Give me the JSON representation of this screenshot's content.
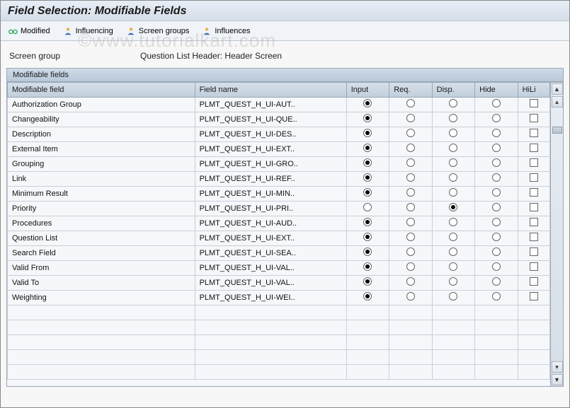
{
  "title": "Field Selection: Modifiable Fields",
  "toolbar": {
    "modified": "Modified",
    "influencing": "Influencing",
    "screen_groups": "Screen groups",
    "influences": "Influences"
  },
  "info": {
    "label": "Screen group",
    "value": "Question List Header: Header Screen"
  },
  "panel_title": "Modifiable fields",
  "columns": {
    "field": "Modifiable field",
    "name": "Field name",
    "input": "Input",
    "req": "Req.",
    "disp": "Disp.",
    "hide": "Hide",
    "hili": "HiLi"
  },
  "rows": [
    {
      "field": "Authorization Group",
      "name": "PLMT_QUEST_H_UI-AUT..",
      "sel": "input"
    },
    {
      "field": "Changeability",
      "name": "PLMT_QUEST_H_UI-QUE..",
      "sel": "input"
    },
    {
      "field": "Description",
      "name": "PLMT_QUEST_H_UI-DES..",
      "sel": "input"
    },
    {
      "field": "External Item",
      "name": "PLMT_QUEST_H_UI-EXT..",
      "sel": "input"
    },
    {
      "field": "Grouping",
      "name": "PLMT_QUEST_H_UI-GRO..",
      "sel": "input"
    },
    {
      "field": "Link",
      "name": "PLMT_QUEST_H_UI-REF..",
      "sel": "input"
    },
    {
      "field": "Minimum Result",
      "name": "PLMT_QUEST_H_UI-MIN..",
      "sel": "input"
    },
    {
      "field": "Priority",
      "name": "PLMT_QUEST_H_UI-PRI..",
      "sel": "disp"
    },
    {
      "field": "Procedures",
      "name": "PLMT_QUEST_H_UI-AUD..",
      "sel": "input"
    },
    {
      "field": "Question List",
      "name": "PLMT_QUEST_H_UI-EXT..",
      "sel": "input"
    },
    {
      "field": "Search Field",
      "name": "PLMT_QUEST_H_UI-SEA..",
      "sel": "input"
    },
    {
      "field": "Valid From",
      "name": "PLMT_QUEST_H_UI-VAL..",
      "sel": "input"
    },
    {
      "field": "Valid To",
      "name": "PLMT_QUEST_H_UI-VAL..",
      "sel": "input"
    },
    {
      "field": "Weighting",
      "name": "PLMT_QUEST_H_UI-WEI..",
      "sel": "input"
    }
  ],
  "empty_rows": 5,
  "watermark": "©www.tutorialkart.com"
}
